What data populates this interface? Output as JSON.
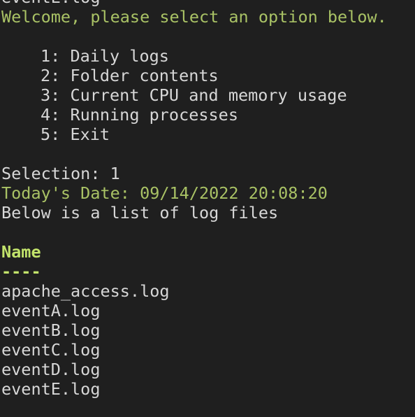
{
  "terminal": {
    "cutoff_top_line": "eventE.log",
    "welcome": "Welcome, please select an option below.",
    "menu": [
      "1: Daily logs",
      "2: Folder contents",
      "3: Current CPU and memory usage",
      "4: Running processes",
      "5: Exit"
    ],
    "selection": "Selection: 1",
    "date_line": "Today's Date: 09/14/2022 20:08:20",
    "list_intro": "Below is a list of log files",
    "column_header": "Name",
    "column_underline": "----",
    "files": [
      "apache_access.log",
      "eventA.log",
      "eventB.log",
      "eventC.log",
      "eventD.log",
      "eventE.log"
    ]
  },
  "colors": {
    "background": "#1f1f1f",
    "text": "#d7d7d7",
    "accent_green": "#a9c265",
    "header_green": "#c2e36b"
  }
}
